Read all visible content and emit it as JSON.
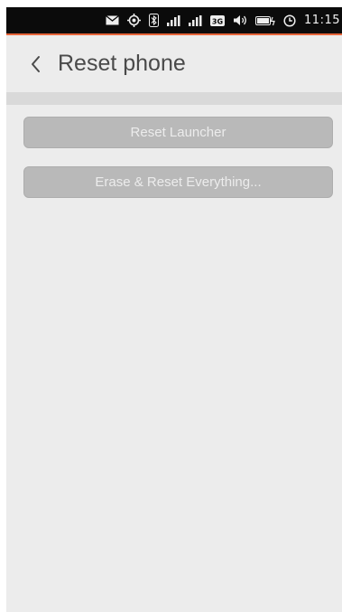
{
  "status_bar": {
    "icons": [
      "mail-icon",
      "gps-icon",
      "bluetooth-icon",
      "signal-icon",
      "signal-icon",
      "3g-icon",
      "volume-icon",
      "battery-icon",
      "alarm-icon"
    ],
    "badge_3g": "3G",
    "time": "11:15"
  },
  "header": {
    "back_icon": "chevron-left-icon",
    "title": "Reset phone"
  },
  "actions": {
    "reset_launcher": "Reset Launcher",
    "erase_reset": "Erase & Reset Everything..."
  },
  "colors": {
    "accent": "#e8653a",
    "background": "#ececec",
    "button": "#b9b9b9"
  }
}
